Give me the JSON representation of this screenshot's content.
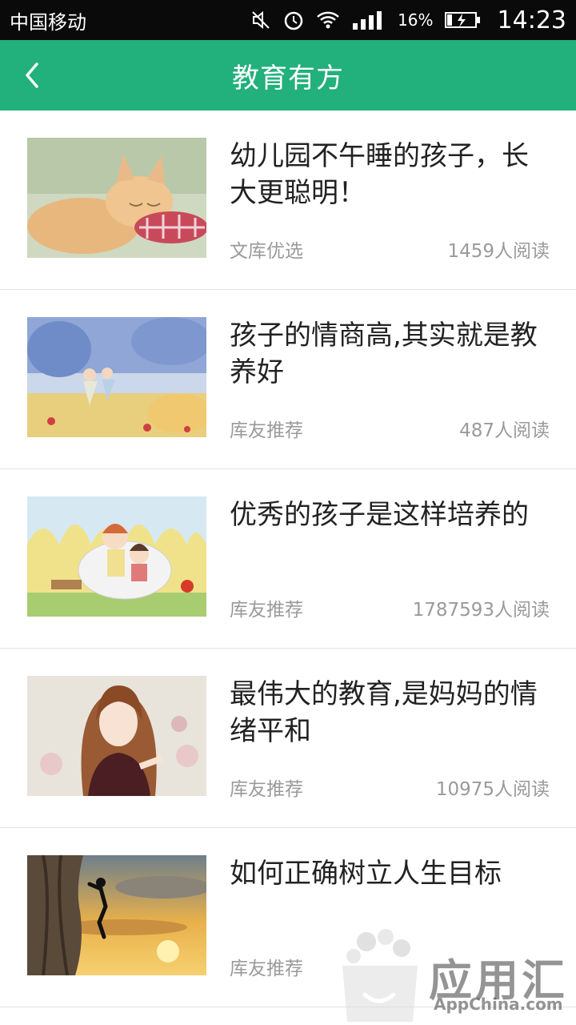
{
  "status_bar": {
    "carrier": "中国移动",
    "battery": "16%",
    "time": "14:23"
  },
  "header": {
    "title": "教育有方"
  },
  "articles": [
    {
      "title": "幼儿园不午睡的孩子，长大更聪明！",
      "source": "文库优选",
      "reads": "1459人阅读",
      "image": "sleeping-kitten"
    },
    {
      "title": "孩子的情商高,其实就是教养好",
      "source": "库友推荐",
      "reads": "487人阅读",
      "image": "watercolor-children"
    },
    {
      "title": "优秀的孩子是这样培养的",
      "source": "库友推荐",
      "reads": "1787593人阅读",
      "image": "reading-kids"
    },
    {
      "title": "最伟大的教育,是妈妈的情绪平和",
      "source": "库友推荐",
      "reads": "10975人阅读",
      "image": "illustrated-woman"
    },
    {
      "title": "如何正确树立人生目标",
      "source": "库友推荐",
      "reads": "",
      "image": "cliff-climber"
    }
  ],
  "watermark": {
    "text": "应用汇",
    "sub": "AppChina.com"
  },
  "colors": {
    "accent": "#22b07d",
    "status_bar": "#0a0a0a",
    "meta_text": "#9a9a9a"
  }
}
